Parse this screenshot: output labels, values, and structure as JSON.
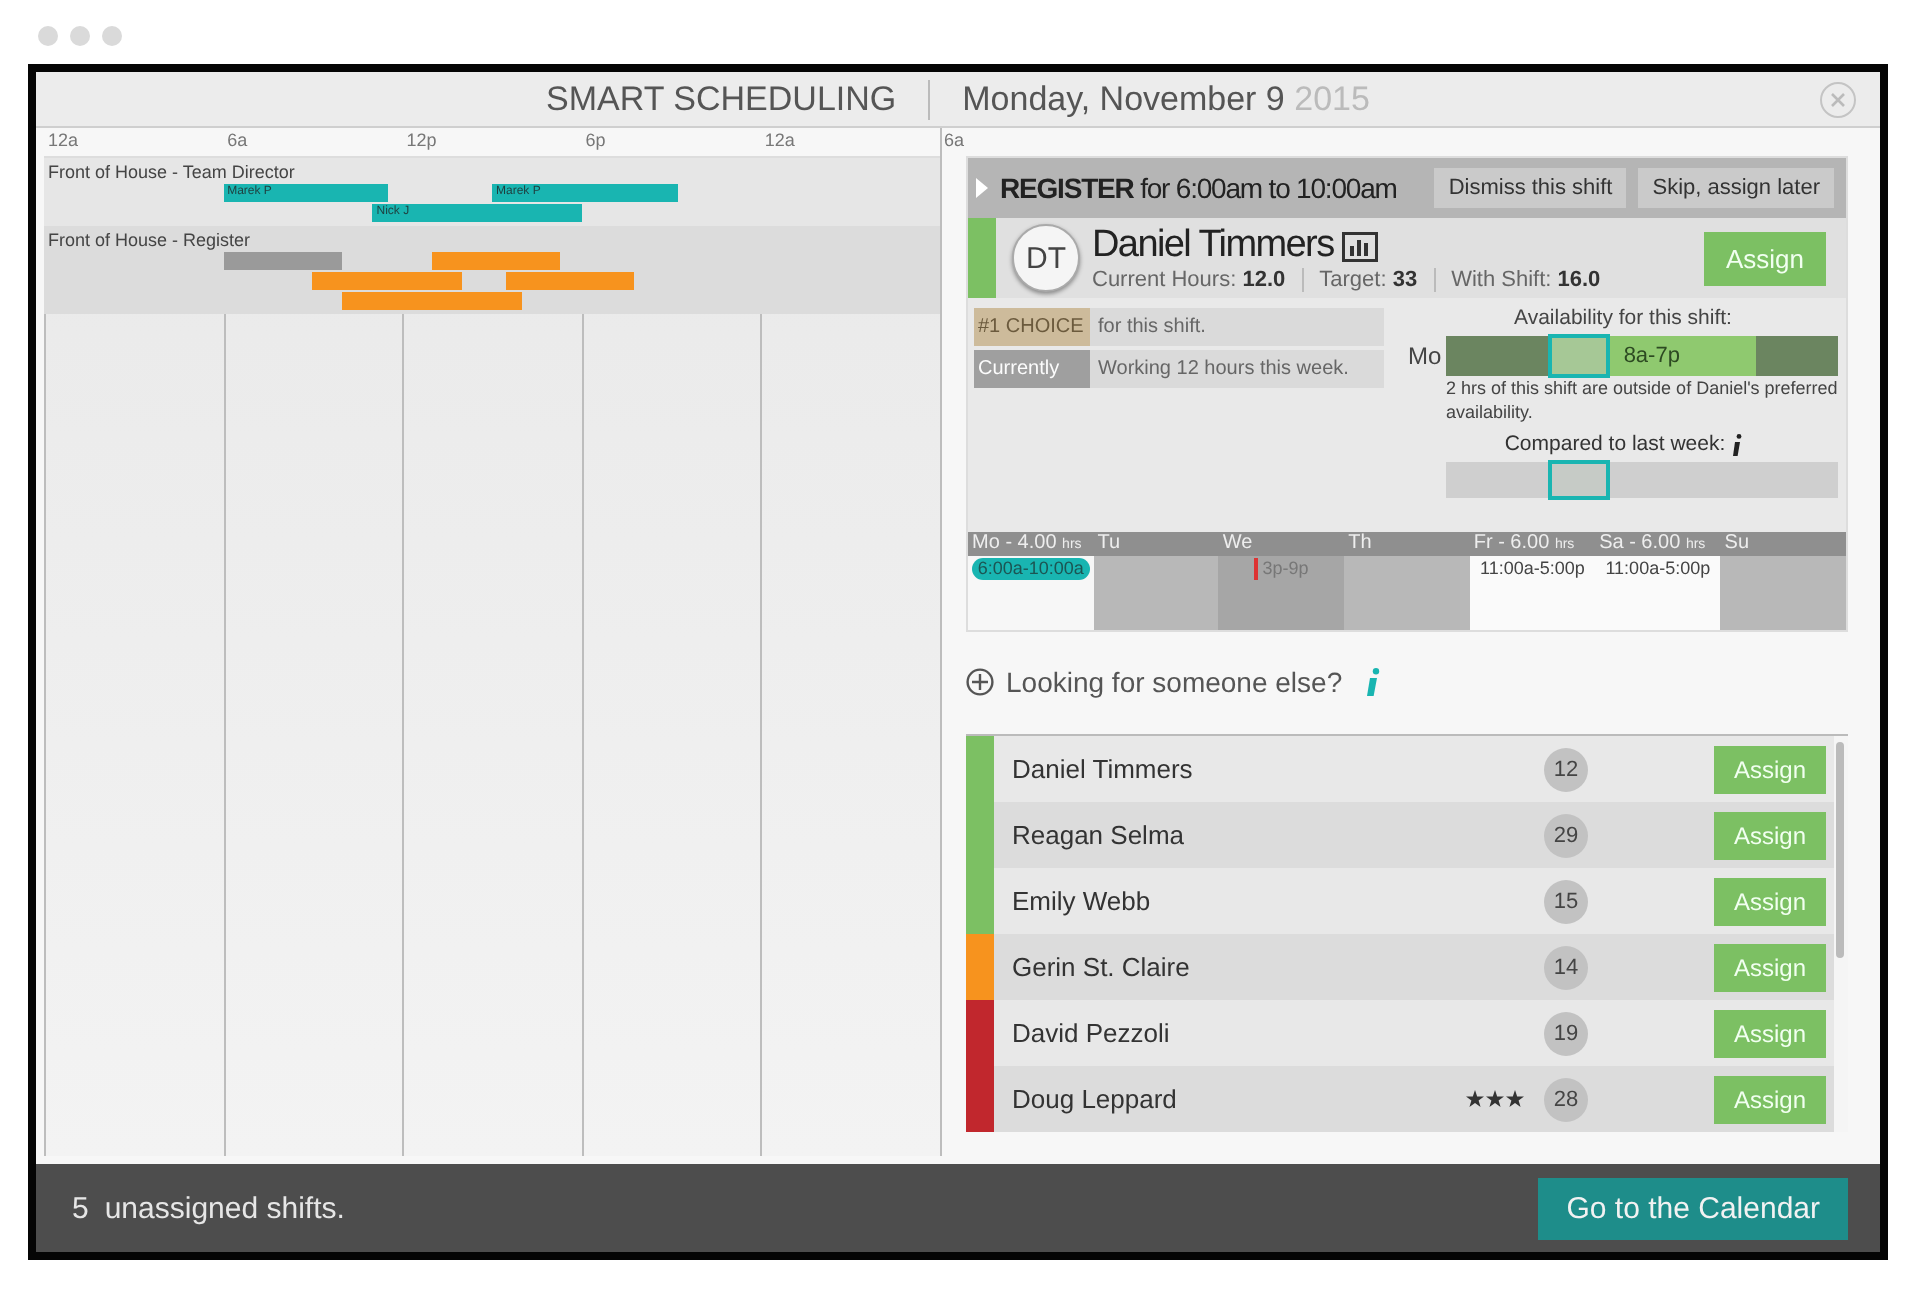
{
  "header": {
    "title": "SMART SCHEDULING",
    "date": "Monday, November 9",
    "year": "2015"
  },
  "timeline": {
    "ticks": [
      "12a",
      "6a",
      "12p",
      "6p",
      "12a",
      "6a"
    ],
    "groups": [
      {
        "name": "Front of House - Team Director",
        "lanes": [
          [
            {
              "label": "Marek P",
              "color": "#19b5b1"
            },
            {
              "label": "Marek P",
              "color": "#19b5b1"
            }
          ],
          [
            {
              "label": "Nick J",
              "color": "#19b5b1"
            }
          ]
        ]
      },
      {
        "name": "Front of House - Register",
        "lanes": [
          [
            {
              "color": "#9a9a9a"
            },
            {
              "color": "#f7931e"
            }
          ],
          [
            {
              "color": "#f7931e"
            },
            {
              "color": "#f7931e"
            }
          ],
          [
            {
              "color": "#f7931e"
            }
          ]
        ]
      }
    ]
  },
  "shift": {
    "role": "REGISTER",
    "time": "for 6:00am to 10:00am",
    "actions": [
      "Dismiss this shift",
      "Skip, assign later"
    ]
  },
  "candidate": {
    "initials": "DT",
    "name": "Daniel Timmers",
    "color": "#7cc063",
    "stats": [
      {
        "label": "Current Hours:",
        "value": "12.0"
      },
      {
        "label": "Target:",
        "value": "33"
      },
      {
        "label": "With Shift:",
        "value": "16.0"
      }
    ],
    "button": "Assign"
  },
  "facts": [
    {
      "kind": "choice",
      "tag": "#1 CHOICE",
      "text": "for this shift."
    },
    {
      "kind": "status",
      "tag": "Currently",
      "text": "Working 12 hours this week."
    }
  ],
  "availability": {
    "title": "Availability for this shift:",
    "day": "Mo",
    "window": "8a-7p",
    "note": "2 hrs of this shift are outside of Daniel's preferred availability.",
    "compare_title": "Compared to last week:"
  },
  "week": [
    {
      "day": "Mo",
      "hours": "- 4.00",
      "unit": "hrs",
      "shift": "6:00a-10:00a",
      "kind": "current"
    },
    {
      "day": "Tu",
      "kind": "off"
    },
    {
      "day": "We",
      "shift": "3p-9p",
      "kind": "conflict"
    },
    {
      "day": "Th",
      "kind": "off"
    },
    {
      "day": "Fr",
      "hours": "- 6.00",
      "unit": "hrs",
      "shift": "11:00a-5:00p",
      "kind": "scheduled"
    },
    {
      "day": "Sa",
      "hours": "- 6.00",
      "unit": "hrs",
      "shift": "11:00a-5:00p",
      "kind": "scheduled"
    },
    {
      "day": "Su",
      "kind": "off"
    }
  ],
  "search": {
    "label": "Looking for someone else?"
  },
  "people": [
    {
      "name": "Daniel Timmers",
      "count": "12",
      "color": "#7cc063",
      "button": "Assign"
    },
    {
      "name": "Reagan Selma",
      "count": "29",
      "color": "#7cc063",
      "button": "Assign"
    },
    {
      "name": "Emily Webb",
      "count": "15",
      "color": "#7cc063",
      "button": "Assign"
    },
    {
      "name": "Gerin St. Claire",
      "count": "14",
      "color": "#f7931e",
      "button": "Assign"
    },
    {
      "name": "David Pezzoli",
      "count": "19",
      "color": "#c1272d",
      "button": "Assign"
    },
    {
      "name": "Doug Leppard",
      "count": "28",
      "color": "#c1272d",
      "stars": 3,
      "button": "Assign"
    }
  ],
  "footer": {
    "count": "5",
    "text": "unassigned shifts.",
    "button": "Go to the Calendar"
  }
}
